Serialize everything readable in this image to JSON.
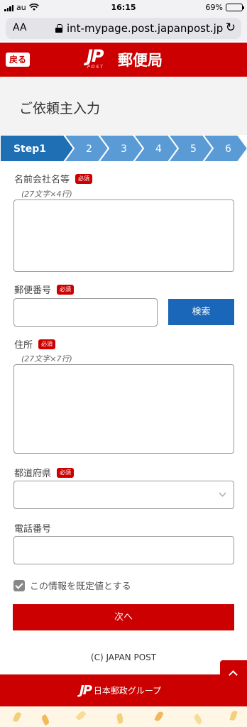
{
  "status_bar": {
    "carrier": "au",
    "time": "16:15",
    "battery": "69%",
    "battery_level": 0.69
  },
  "browser": {
    "aa_label": "AA",
    "url": "int-mypage.post.japanpost.jp"
  },
  "header": {
    "back_label": "戻る",
    "logo_mark": "JP",
    "logo_sub": "POST",
    "logo_name": "郵便局"
  },
  "page": {
    "title": "ご依頼主入力"
  },
  "steps": [
    {
      "label": "Step1",
      "active": true
    },
    {
      "label": "2",
      "active": false
    },
    {
      "label": "3",
      "active": false
    },
    {
      "label": "4",
      "active": false
    },
    {
      "label": "5",
      "active": false
    },
    {
      "label": "6",
      "active": false
    }
  ],
  "form": {
    "required_badge": "必須",
    "name": {
      "label": "名前会社名等",
      "hint": "(27文字×4行)",
      "value": ""
    },
    "postal": {
      "label": "郵便番号",
      "value": "",
      "search_label": "検索"
    },
    "address": {
      "label": "住所",
      "hint": "(27文字×7行)",
      "value": ""
    },
    "prefecture": {
      "label": "都道府県",
      "value": ""
    },
    "phone": {
      "label": "電話番号",
      "value": ""
    },
    "default_checkbox": {
      "label": "この情報を既定値とする",
      "checked": true
    },
    "next_label": "次へ"
  },
  "footer": {
    "copyright": "(C) JAPAN POST",
    "group_mark": "JP",
    "group_name": "日本郵政グループ"
  },
  "colors": {
    "brand_red": "#cc0000",
    "step_active": "#1f6fb5",
    "step_inactive": "#5b9bd5",
    "button_blue": "#1a66b8"
  }
}
